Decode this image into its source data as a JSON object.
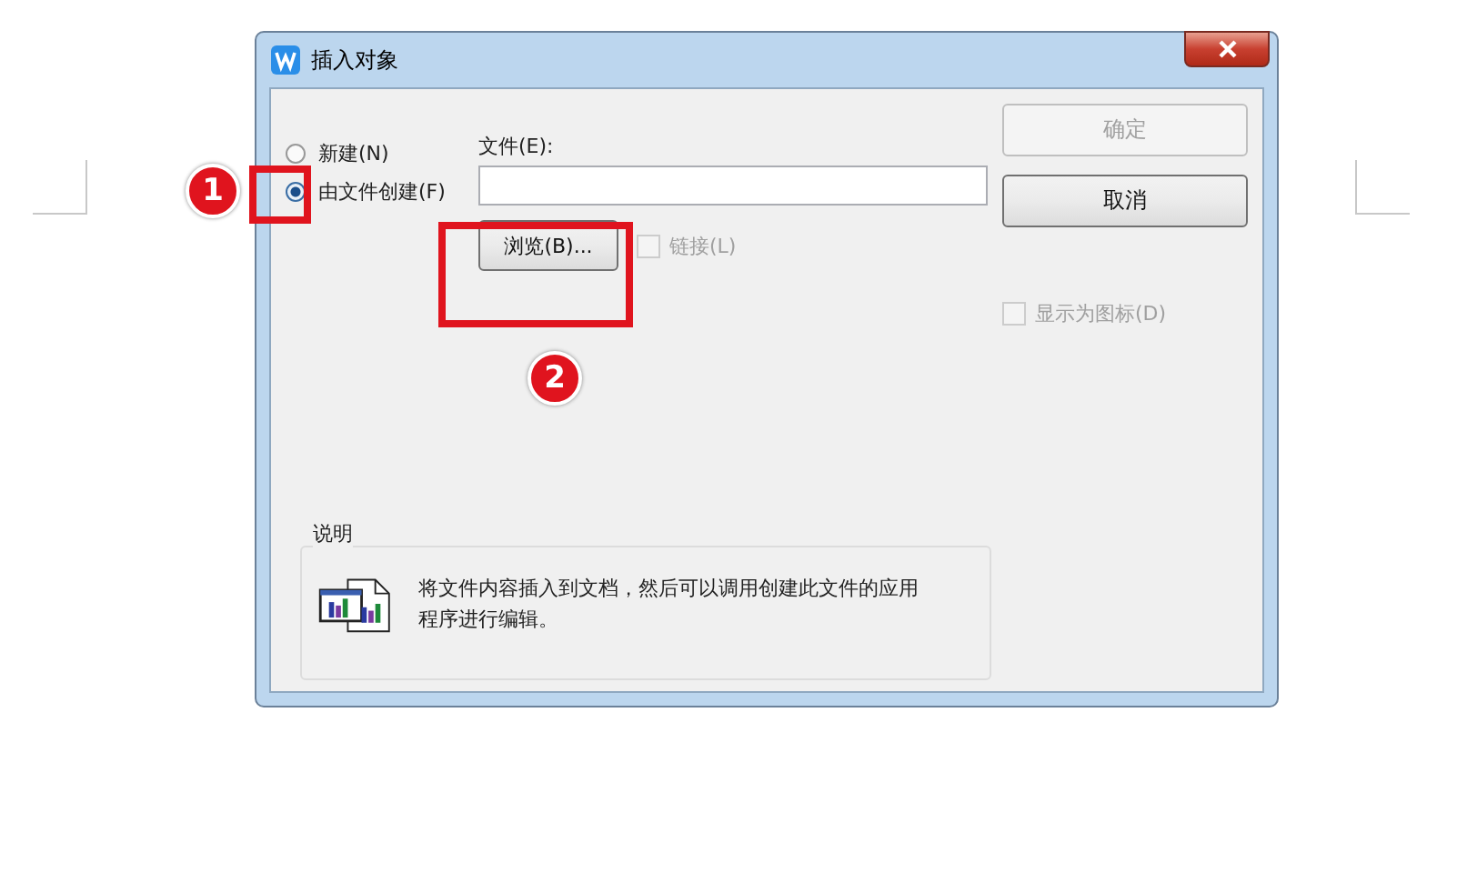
{
  "window": {
    "title": "插入对象"
  },
  "source_options": [
    {
      "label": "新建(N)",
      "selected": false
    },
    {
      "label": "由文件创建(F)",
      "selected": true
    }
  ],
  "file": {
    "label": "文件(E):"
  },
  "browse_button": {
    "label": "浏览(B)..."
  },
  "link_checkbox": {
    "label": "链接(L)",
    "checked": false,
    "disabled": true
  },
  "buttons": [
    {
      "label": "确定",
      "disabled": true
    },
    {
      "label": "取消",
      "disabled": false
    }
  ],
  "display_as_icon": {
    "label": "显示为图标(D)",
    "checked": false,
    "disabled": true
  },
  "description": {
    "title": "说明",
    "text": "将文件内容插入到文档，然后可以调用创建此文件的应用程序进行编辑。"
  },
  "annotations": [
    {
      "number": "1"
    },
    {
      "number": "2"
    }
  ]
}
